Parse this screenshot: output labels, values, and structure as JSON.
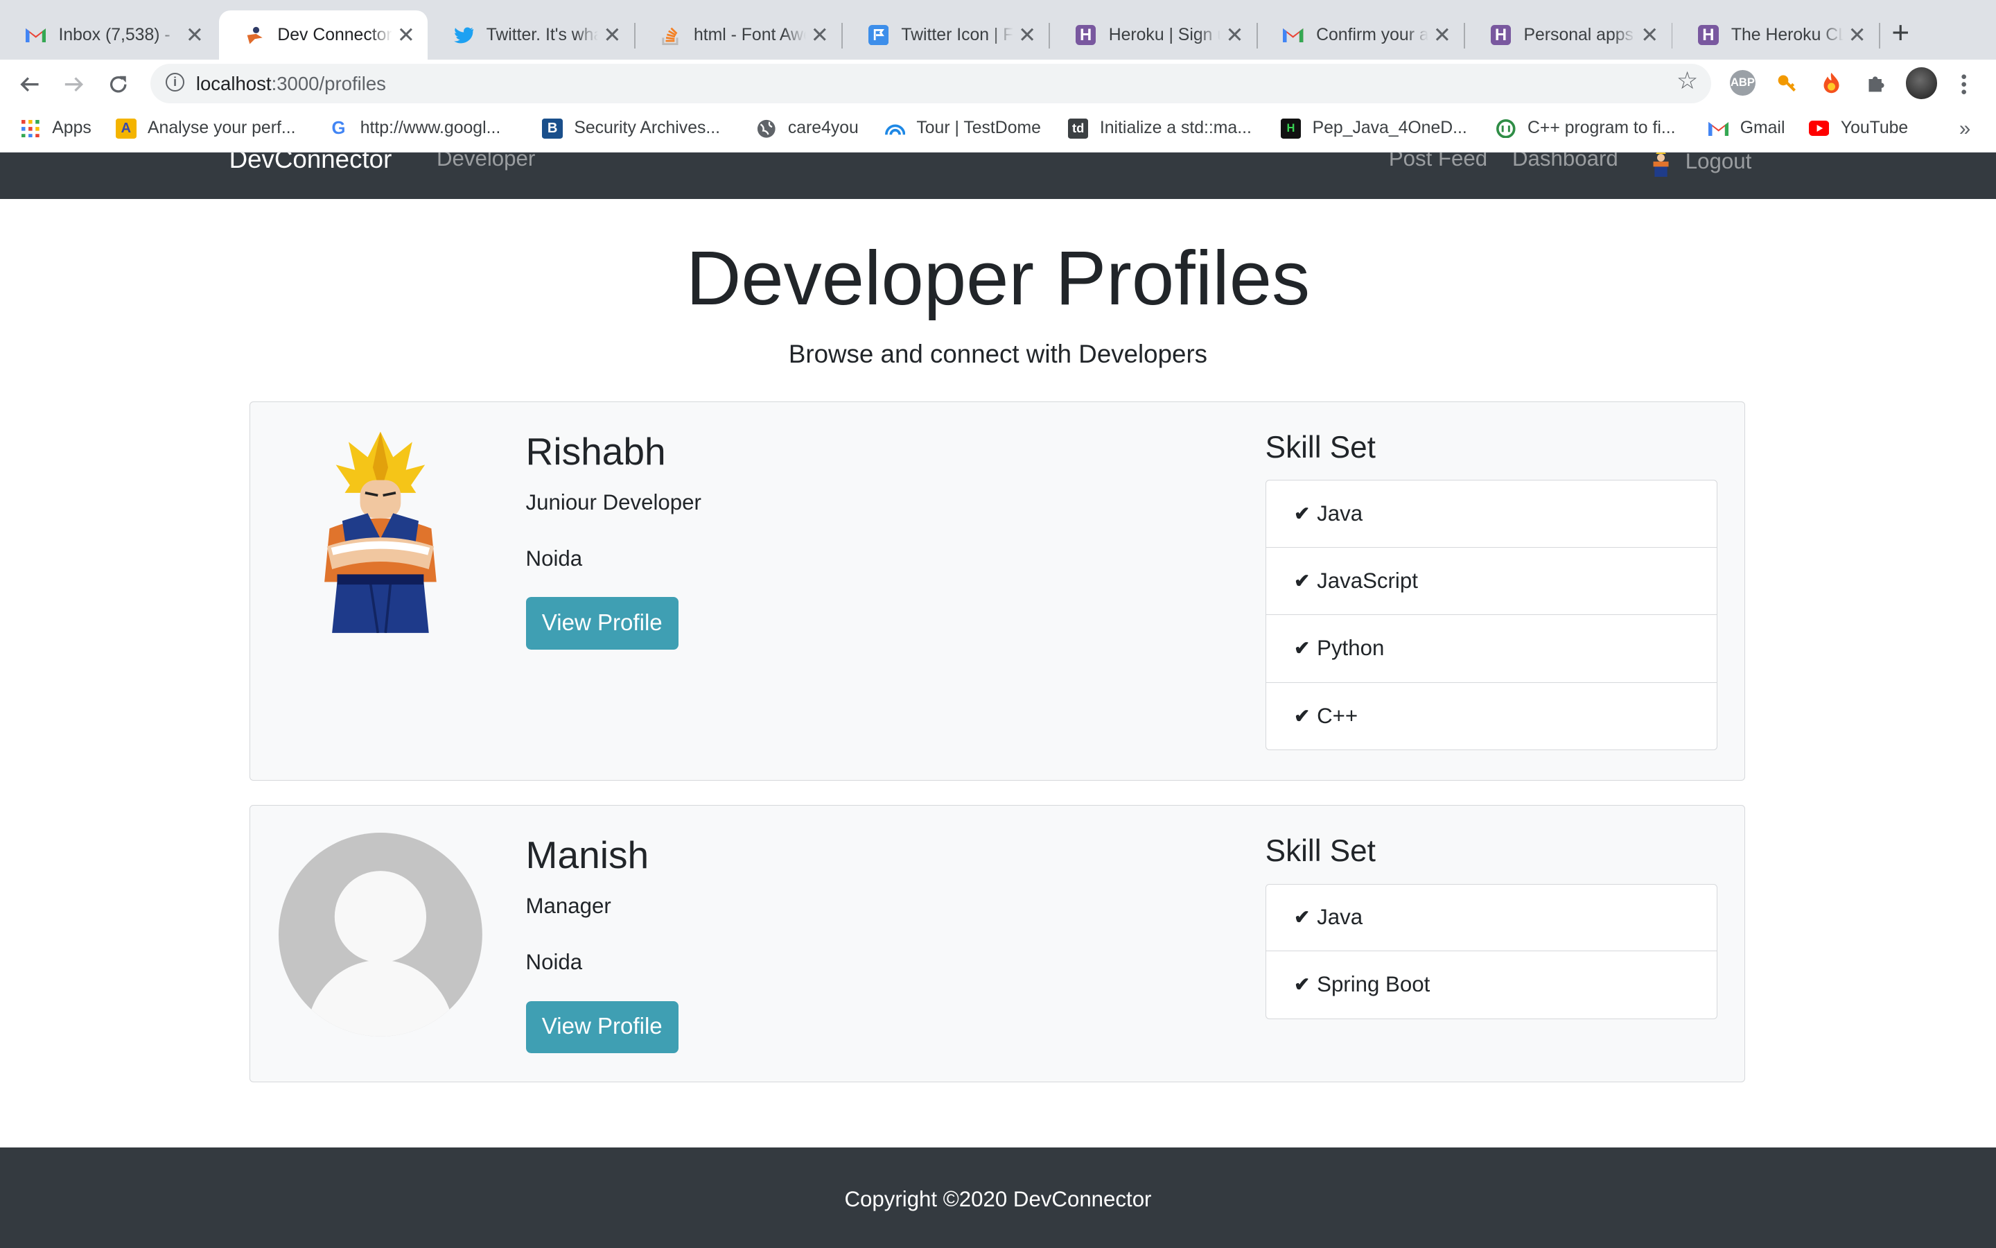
{
  "browser": {
    "tabs": [
      {
        "label": "Inbox (7,538) - ",
        "icon": "gmail-icon",
        "close": "✕"
      },
      {
        "label": "Dev Connector",
        "icon": "devconnector-icon",
        "close": "✕"
      },
      {
        "label": "Twitter. It's wha",
        "icon": "twitter-icon",
        "close": "✕"
      },
      {
        "label": "html - Font Awe",
        "icon": "stackoverflow-icon",
        "close": "✕"
      },
      {
        "label": "Twitter Icon | F",
        "icon": "flag-icon",
        "close": "✕"
      },
      {
        "label": "Heroku | Sign u",
        "icon": "heroku-icon",
        "close": "✕"
      },
      {
        "label": "Confirm your a",
        "icon": "gmail-icon",
        "close": "✕"
      },
      {
        "label": "Personal apps",
        "icon": "heroku-icon",
        "close": "✕"
      },
      {
        "label": "The Heroku CL",
        "icon": "heroku-icon",
        "close": "✕"
      }
    ],
    "new_tab": "+",
    "url_host": "localhost",
    "url_path": ":3000/profiles",
    "bookmarks": [
      {
        "label": "Apps",
        "icon": "apps-grid-icon"
      },
      {
        "label": "Analyse your perf...",
        "icon": "analyse-icon"
      },
      {
        "label": "http://www.googl...",
        "icon": "google-icon"
      },
      {
        "label": "Security Archives...",
        "icon": "security-icon"
      },
      {
        "label": "care4you",
        "icon": "globe-icon"
      },
      {
        "label": "Tour | TestDome",
        "icon": "testdome-icon"
      },
      {
        "label": "Initialize a std::ma...",
        "icon": "td-icon"
      },
      {
        "label": "Pep_Java_4OneD...",
        "icon": "hackerrank-icon"
      },
      {
        "label": "C++ program to fi...",
        "icon": "geeks-icon"
      },
      {
        "label": "Gmail",
        "icon": "gmail-icon"
      },
      {
        "label": "YouTube",
        "icon": "youtube-icon"
      }
    ],
    "bookmarks_more": "»",
    "extensions": {
      "abp": "ABP"
    }
  },
  "navbar": {
    "brand": "DevConnector",
    "developers_link": "Developer",
    "post_feed_link": "Post Feed",
    "dashboard_link": "Dashboard",
    "logout_link": "Logout"
  },
  "header": {
    "title": "Developer Profiles",
    "lead": "Browse and connect with Developers"
  },
  "profiles": [
    {
      "name": "Rishabh",
      "title": "Juniour Developer",
      "location": "Noida",
      "button": "View Profile",
      "avatar": "anime-character-avatar",
      "skills_heading": "Skill Set",
      "skills": [
        "Java",
        "JavaScript",
        "Python",
        "C++"
      ]
    },
    {
      "name": "Manish",
      "title": "Manager",
      "location": "Noida",
      "button": "View Profile",
      "avatar": "default-user-avatar",
      "skills_heading": "Skill Set",
      "skills": [
        "Java",
        "Spring Boot"
      ]
    }
  ],
  "footer": {
    "copyright": "Copyright ©2020 DevConnector"
  },
  "colors": {
    "navbar_bg": "#343a40",
    "button_info": "#3f9fb3",
    "card_bg": "#f8f9fa"
  }
}
